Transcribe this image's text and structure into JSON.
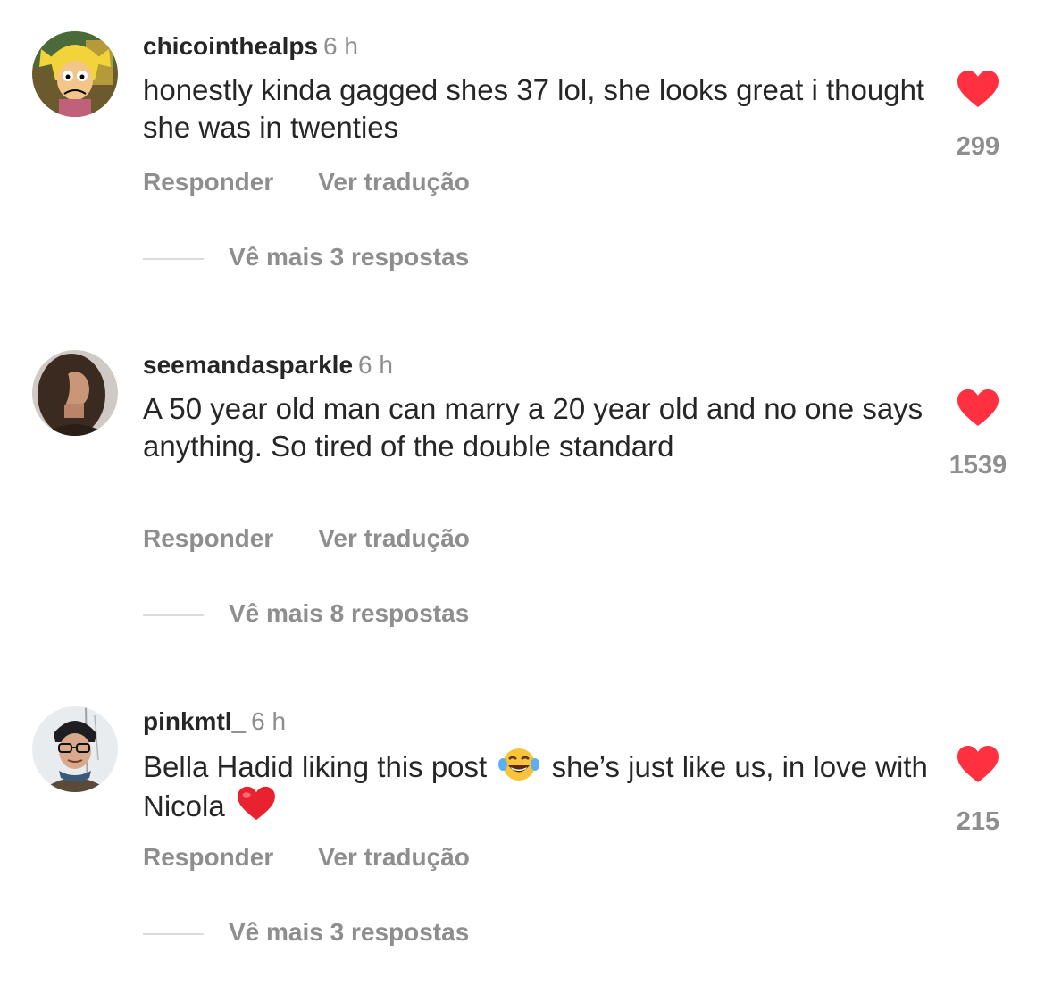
{
  "colors": {
    "like_red": "#ff3040",
    "muted": "#8e8e8e",
    "text": "#262626",
    "divider": "#dbdbdb"
  },
  "comments": [
    {
      "username": "chicointhealps",
      "time": "6 h",
      "text": "honestly kinda gagged shes 37 lol, she looks great i thought she was in twenties",
      "like_count": "299",
      "reply_label": "Responder",
      "translate_label": "Ver tradução",
      "more_replies": "Vê mais 3 respostas",
      "avatar": "cartoon-avatar"
    },
    {
      "username": "seemandasparkle",
      "time": "6 h",
      "text": "A 50 year old man can marry a 20 year old and no one says anything. So tired of the double standard",
      "like_count": "1539",
      "reply_label": "Responder",
      "translate_label": "Ver tradução",
      "more_replies": "Vê mais 8 respostas",
      "avatar": "photo-avatar"
    },
    {
      "username": "pinkmtl_",
      "time": "6 h",
      "text_part1": "Bella Hadid liking this post",
      "emoji1": "laughing-tears-emoji",
      "text_part2": "she’s just like us, in love with Nicola",
      "emoji2": "red-heart-emoji",
      "like_count": "215",
      "reply_label": "Responder",
      "translate_label": "Ver tradução",
      "more_replies": "Vê mais 3 respostas",
      "avatar": "photo-avatar"
    }
  ]
}
